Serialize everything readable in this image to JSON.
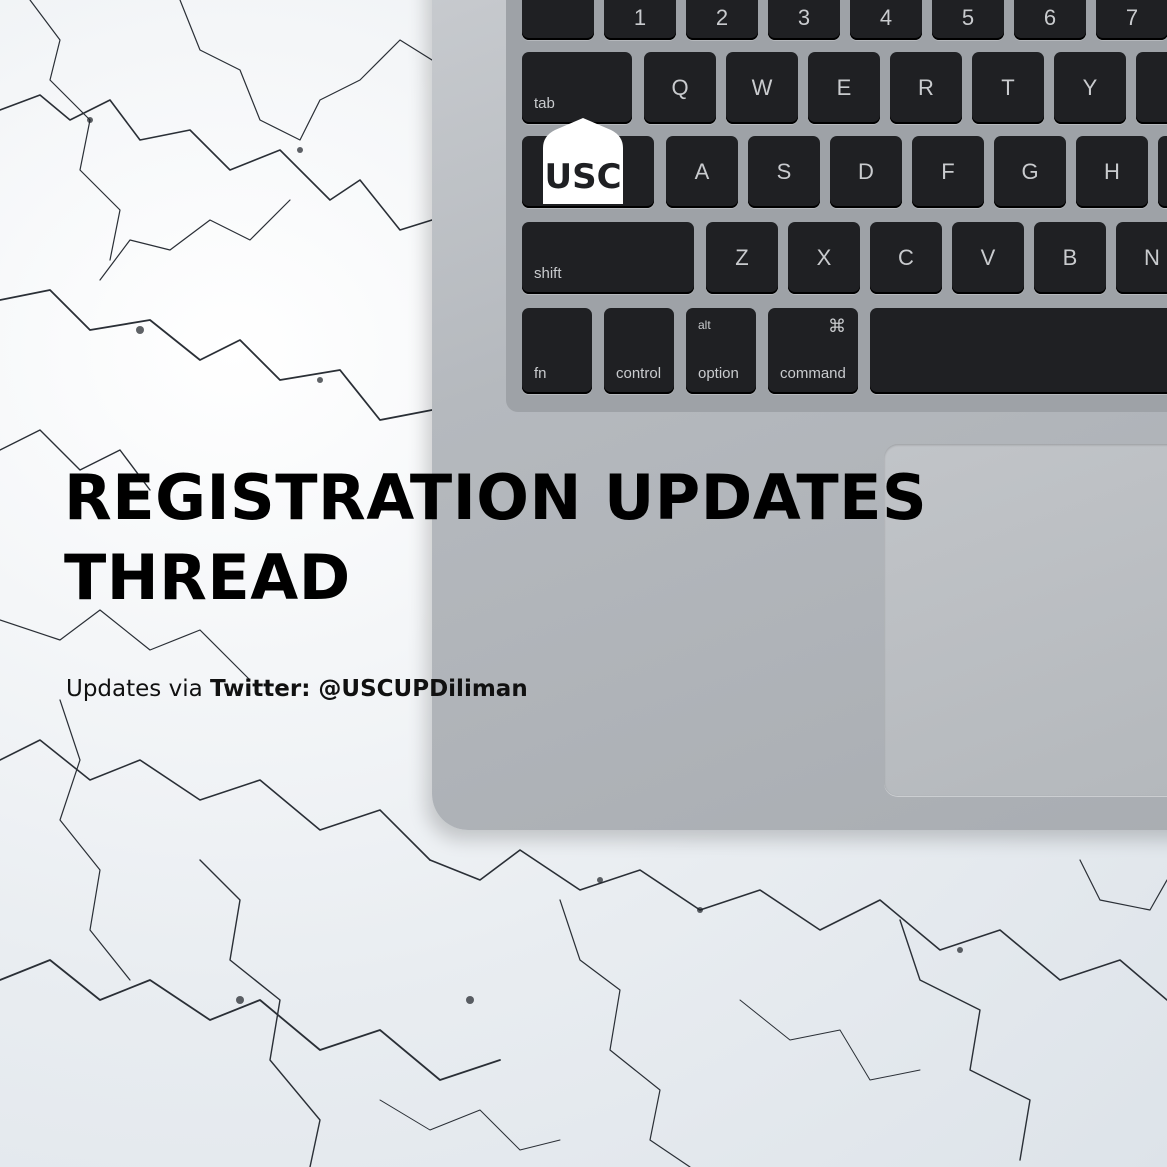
{
  "title_line1": "REGISTRATION UPDATES",
  "title_line2": "THREAD",
  "subtitle_prefix": "Updates via",
  "subtitle_handle": "Twitter: @USCUPDiliman",
  "logo_text": "USC",
  "keys": {
    "row1": [
      "1",
      "2",
      "3",
      "4",
      "5",
      "6",
      "7"
    ],
    "tab": "tab",
    "row2": [
      "Q",
      "W",
      "E",
      "R",
      "T",
      "Y"
    ],
    "row3": [
      "A",
      "S",
      "D",
      "F",
      "G",
      "H"
    ],
    "shift": "shift",
    "row4": [
      "Z",
      "X",
      "C",
      "V",
      "B",
      "N"
    ],
    "fn": "fn",
    "control": "control",
    "alt": "alt",
    "option": "option",
    "cmd_symbol": "⌘",
    "command": "command"
  },
  "colors": {
    "title": "#000000",
    "key": "#1f2023",
    "aluminum": "#b5b9be"
  }
}
